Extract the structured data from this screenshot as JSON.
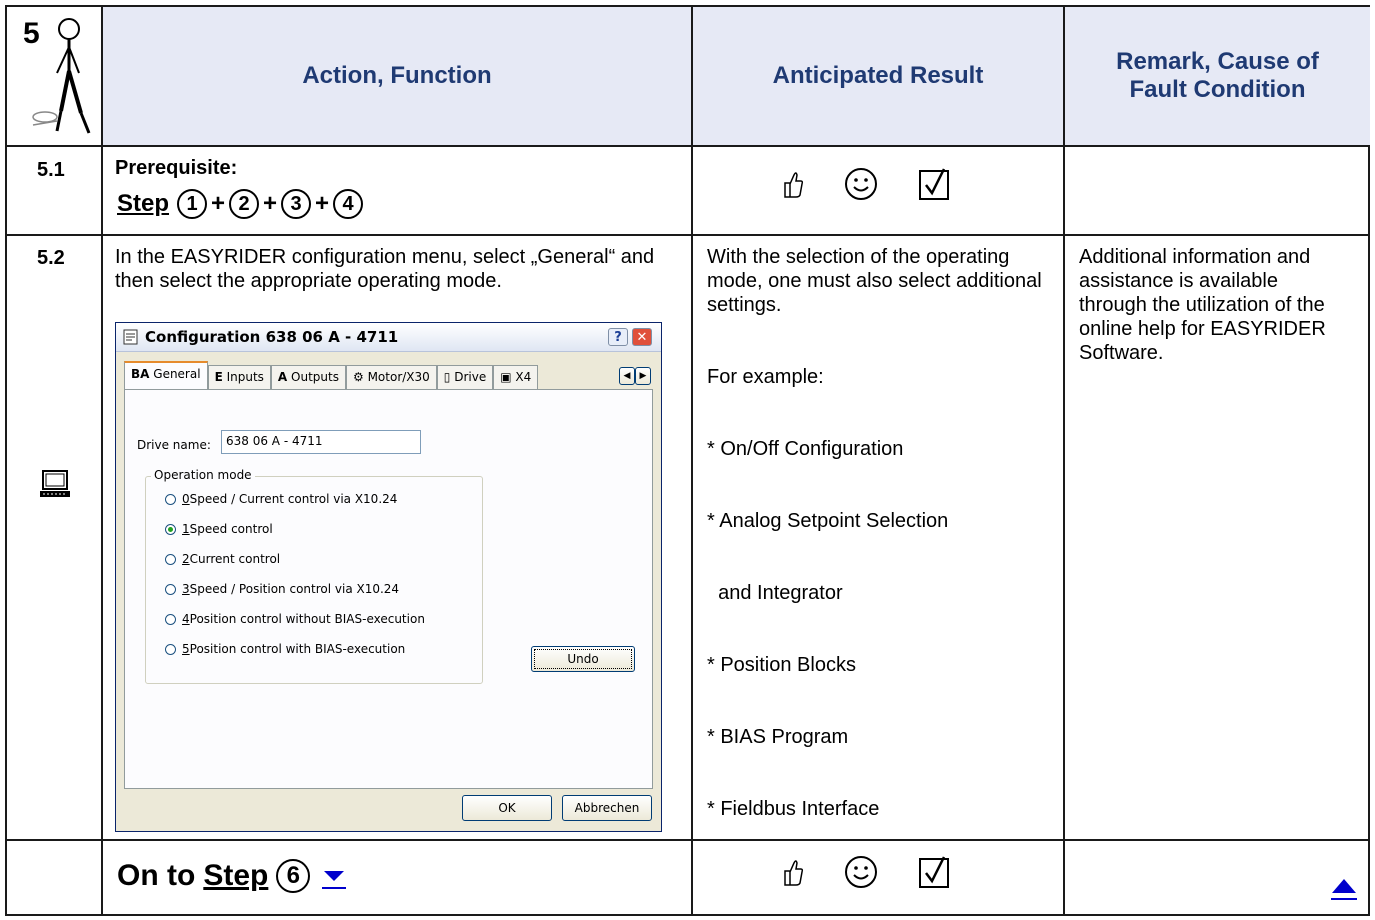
{
  "header": {
    "step_number": "5",
    "col_action": "Action, Function",
    "col_result": "Anticipated Result",
    "col_remark": "Remark, Cause of Fault Condition"
  },
  "row1": {
    "number": "5.1",
    "prereq_label": "Prerequisite:",
    "step_label": "Step",
    "steps": [
      "1",
      "2",
      "3",
      "4"
    ],
    "plus": "+"
  },
  "row2": {
    "number": "5.2",
    "action_text": "In the EASYRIDER configuration menu, select „General“ and then select the appropriate operating mode.",
    "result_line1": "With the selection of the operating mode, one must also select additional settings.",
    "result_example": "For example:",
    "result_items": [
      "* On/Off Configuration",
      "* Analog Setpoint Selection",
      "  and Integrator",
      "* Position Blocks",
      "* BIAS Program",
      "* Fieldbus Interface"
    ],
    "remark": "Additional information and assistance is available through the utilization of the online help for EASYRIDER Software."
  },
  "dialog": {
    "title": "Configuration 638 06 A - 4711",
    "help_btn": "?",
    "close_btn": "✕",
    "tabs": [
      {
        "prefix": "BA",
        "label": "General"
      },
      {
        "prefix": "E",
        "label": "Inputs"
      },
      {
        "prefix": "A",
        "label": "Outputs"
      },
      {
        "prefix": "",
        "label": "Motor/X30"
      },
      {
        "prefix": "",
        "label": "Drive"
      },
      {
        "prefix": "",
        "label": "X4"
      }
    ],
    "tab_scroll_left": "◀",
    "tab_scroll_right": "▶",
    "drive_name_label": "Drive name:",
    "drive_name_value": "638 06 A - 4711",
    "group_label": "Operation mode",
    "modes": [
      {
        "key": "0",
        "label": " Speed / Current control via X10.24"
      },
      {
        "key": "1",
        "label": " Speed control"
      },
      {
        "key": "2",
        "label": " Current control"
      },
      {
        "key": "3",
        "label": " Speed / Position control via X10.24"
      },
      {
        "key": "4",
        "label": " Position control without BIAS-execution"
      },
      {
        "key": "5",
        "label": " Position control with BIAS-execution"
      }
    ],
    "selected_mode": 1,
    "undo": "Undo",
    "ok": "OK",
    "cancel": "Abbrechen"
  },
  "footer": {
    "on_to": "On to",
    "step_label": "Step",
    "next_step": "6"
  },
  "icons": {
    "accent": "#1f3a73",
    "link_color": "#0000cc",
    "header_bg": "#e6e9f5"
  }
}
